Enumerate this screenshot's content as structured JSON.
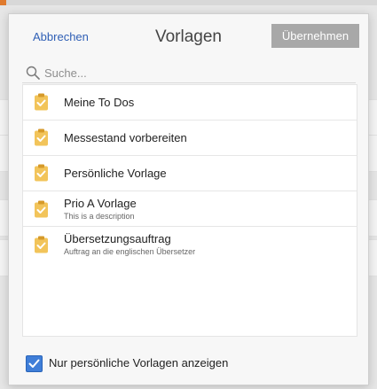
{
  "header": {
    "cancel_label": "Abbrechen",
    "title": "Vorlagen",
    "apply_label": "Übernehmen"
  },
  "search": {
    "placeholder": "Suche..."
  },
  "templates": [
    {
      "name": "Meine To Dos",
      "description": ""
    },
    {
      "name": "Messestand vorbereiten",
      "description": ""
    },
    {
      "name": "Persönliche Vorlage",
      "description": ""
    },
    {
      "name": "Prio A Vorlage",
      "description": "This is a description"
    },
    {
      "name": "Übersetzungsauftrag",
      "description": "Auftrag an die englischen Übersetzer"
    }
  ],
  "footer": {
    "checkbox_label": "Nur persönliche Vorlagen anzeigen",
    "checkbox_checked": true
  },
  "colors": {
    "accent": "#2f5fb5",
    "apply_button": "#a8a8a8",
    "checkbox": "#3f7ed8",
    "template_icon": "#f2c45a"
  },
  "icons": {
    "search": "search-icon",
    "template": "clipboard-check-icon",
    "checkbox": "checkmark-icon"
  }
}
